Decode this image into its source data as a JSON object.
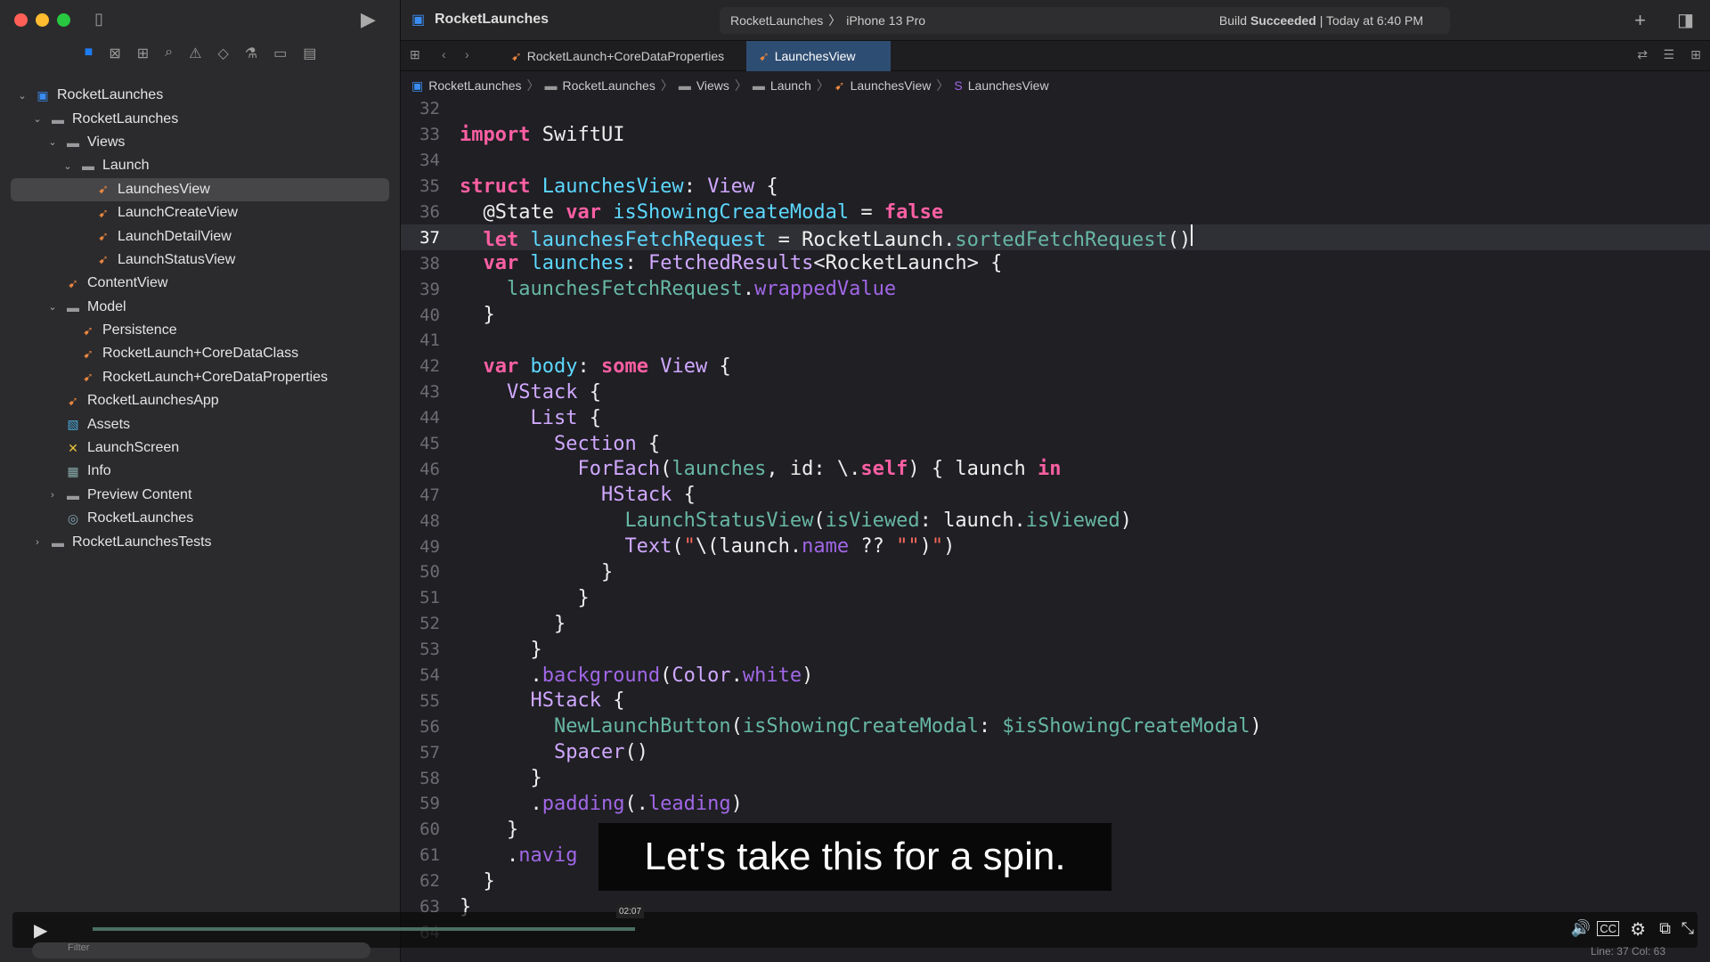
{
  "window": {
    "project": "RocketLaunches",
    "scheme": "RocketLaunches",
    "device": "iPhone 13 Pro",
    "build_status": "Build",
    "build_result": "Succeeded",
    "build_time": "| Today at 6:40 PM"
  },
  "tabs": [
    {
      "label": "RocketLaunch+CoreDataProperties"
    },
    {
      "label": "LaunchesView"
    }
  ],
  "breadcrumb": [
    "RocketLaunches",
    "RocketLaunches",
    "Views",
    "Launch",
    "LaunchesView",
    "LaunchesView"
  ],
  "tree": [
    {
      "label": "RocketLaunches",
      "icon": "app-project",
      "depth": 0,
      "chev": "v"
    },
    {
      "label": "RocketLaunches",
      "icon": "folder",
      "depth": 1,
      "chev": "v"
    },
    {
      "label": "Views",
      "icon": "folder",
      "depth": 2,
      "chev": "v"
    },
    {
      "label": "Launch",
      "icon": "folder",
      "depth": 3,
      "chev": "v"
    },
    {
      "label": "LaunchesView",
      "icon": "swift",
      "depth": 4,
      "selected": true
    },
    {
      "label": "LaunchCreateView",
      "icon": "swift",
      "depth": 4
    },
    {
      "label": "LaunchDetailView",
      "icon": "swift",
      "depth": 4
    },
    {
      "label": "LaunchStatusView",
      "icon": "swift",
      "depth": 4
    },
    {
      "label": "ContentView",
      "icon": "swift",
      "depth": 2
    },
    {
      "label": "Model",
      "icon": "folder",
      "depth": 2,
      "chev": "v"
    },
    {
      "label": "Persistence",
      "icon": "swift",
      "depth": 3
    },
    {
      "label": "RocketLaunch+CoreDataClass",
      "icon": "swift",
      "depth": 3
    },
    {
      "label": "RocketLaunch+CoreDataProperties",
      "icon": "swift",
      "depth": 3
    },
    {
      "label": "RocketLaunchesApp",
      "icon": "swift",
      "depth": 2
    },
    {
      "label": "Assets",
      "icon": "assets",
      "depth": 2
    },
    {
      "label": "LaunchScreen",
      "icon": "storyboard",
      "depth": 2
    },
    {
      "label": "Info",
      "icon": "plist",
      "depth": 2
    },
    {
      "label": "Preview Content",
      "icon": "folder",
      "depth": 2,
      "chev": ">"
    },
    {
      "label": "RocketLaunches",
      "icon": "coredata-model",
      "depth": 2
    },
    {
      "label": "RocketLaunchesTests",
      "icon": "folder",
      "depth": 1,
      "chev": ">"
    }
  ],
  "code": {
    "current_line": 37,
    "lines": [
      {
        "n": "32",
        "t": []
      },
      {
        "n": "33",
        "t": [
          [
            "kw",
            "import"
          ],
          [
            "plain",
            " SwiftUI"
          ]
        ]
      },
      {
        "n": "34",
        "t": []
      },
      {
        "n": "35",
        "t": [
          [
            "kw",
            "struct"
          ],
          [
            "plain",
            " "
          ],
          [
            "decl",
            "LaunchesView"
          ],
          [
            "plain",
            ": "
          ],
          [
            "type",
            "View"
          ],
          [
            "plain",
            " {"
          ]
        ]
      },
      {
        "n": "36",
        "t": [
          [
            "plain",
            "  @State "
          ],
          [
            "kw",
            "var"
          ],
          [
            "plain",
            " "
          ],
          [
            "decl",
            "isShowingCreateModal"
          ],
          [
            "plain",
            " = "
          ],
          [
            "kw",
            "false"
          ]
        ]
      },
      {
        "n": "37",
        "t": [
          [
            "plain",
            "  "
          ],
          [
            "kw",
            "let"
          ],
          [
            "plain",
            " "
          ],
          [
            "decl",
            "launchesFetchRequest"
          ],
          [
            "plain",
            " = RocketLaunch."
          ],
          [
            "proj",
            "sortedFetchRequest"
          ],
          [
            "plain",
            "()"
          ]
        ]
      },
      {
        "n": "38",
        "t": [
          [
            "plain",
            "  "
          ],
          [
            "kw",
            "var"
          ],
          [
            "plain",
            " "
          ],
          [
            "decl",
            "launches"
          ],
          [
            "plain",
            ": "
          ],
          [
            "type",
            "FetchedResults"
          ],
          [
            "plain",
            "<RocketLaunch> {"
          ]
        ]
      },
      {
        "n": "39",
        "t": [
          [
            "plain",
            "    "
          ],
          [
            "proj",
            "launchesFetchRequest"
          ],
          [
            "plain",
            "."
          ],
          [
            "sys",
            "wrappedValue"
          ]
        ]
      },
      {
        "n": "40",
        "t": [
          [
            "plain",
            "  }"
          ]
        ]
      },
      {
        "n": "41",
        "t": []
      },
      {
        "n": "42",
        "t": [
          [
            "plain",
            "  "
          ],
          [
            "kw",
            "var"
          ],
          [
            "plain",
            " "
          ],
          [
            "decl",
            "body"
          ],
          [
            "plain",
            ": "
          ],
          [
            "kw",
            "some"
          ],
          [
            "plain",
            " "
          ],
          [
            "type",
            "View"
          ],
          [
            "plain",
            " {"
          ]
        ]
      },
      {
        "n": "43",
        "t": [
          [
            "plain",
            "    "
          ],
          [
            "type",
            "VStack"
          ],
          [
            "plain",
            " {"
          ]
        ]
      },
      {
        "n": "44",
        "t": [
          [
            "plain",
            "      "
          ],
          [
            "type",
            "List"
          ],
          [
            "plain",
            " {"
          ]
        ]
      },
      {
        "n": "45",
        "t": [
          [
            "plain",
            "        "
          ],
          [
            "type",
            "Section"
          ],
          [
            "plain",
            " {"
          ]
        ]
      },
      {
        "n": "46",
        "t": [
          [
            "plain",
            "          "
          ],
          [
            "type",
            "ForEach"
          ],
          [
            "plain",
            "("
          ],
          [
            "proj",
            "launches"
          ],
          [
            "plain",
            ", id: \\."
          ],
          [
            "kw",
            "self"
          ],
          [
            "plain",
            ") { launch "
          ],
          [
            "kw",
            "in"
          ]
        ]
      },
      {
        "n": "47",
        "t": [
          [
            "plain",
            "            "
          ],
          [
            "type",
            "HStack"
          ],
          [
            "plain",
            " {"
          ]
        ]
      },
      {
        "n": "48",
        "t": [
          [
            "plain",
            "              "
          ],
          [
            "proj",
            "LaunchStatusView"
          ],
          [
            "plain",
            "("
          ],
          [
            "proj",
            "isViewed"
          ],
          [
            "plain",
            ": launch."
          ],
          [
            "proj",
            "isViewed"
          ],
          [
            "plain",
            ")"
          ]
        ]
      },
      {
        "n": "49",
        "t": [
          [
            "plain",
            "              "
          ],
          [
            "type",
            "Text"
          ],
          [
            "plain",
            "("
          ],
          [
            "str",
            "\""
          ],
          [
            "plain",
            "\\(launch."
          ],
          [
            "sys",
            "name"
          ],
          [
            "plain",
            " ?? "
          ],
          [
            "str",
            "\"\""
          ],
          [
            "plain",
            ")"
          ],
          [
            "str",
            "\""
          ],
          [
            "plain",
            ")"
          ]
        ]
      },
      {
        "n": "50",
        "t": [
          [
            "plain",
            "            }"
          ]
        ]
      },
      {
        "n": "51",
        "t": [
          [
            "plain",
            "          }"
          ]
        ]
      },
      {
        "n": "52",
        "t": [
          [
            "plain",
            "        }"
          ]
        ]
      },
      {
        "n": "53",
        "t": [
          [
            "plain",
            "      }"
          ]
        ]
      },
      {
        "n": "54",
        "t": [
          [
            "plain",
            "      ."
          ],
          [
            "sys",
            "background"
          ],
          [
            "plain",
            "("
          ],
          [
            "type",
            "Color"
          ],
          [
            "plain",
            "."
          ],
          [
            "sys",
            "white"
          ],
          [
            "plain",
            ")"
          ]
        ]
      },
      {
        "n": "55",
        "t": [
          [
            "plain",
            "      "
          ],
          [
            "type",
            "HStack"
          ],
          [
            "plain",
            " {"
          ]
        ]
      },
      {
        "n": "56",
        "t": [
          [
            "plain",
            "        "
          ],
          [
            "proj",
            "NewLaunchButton"
          ],
          [
            "plain",
            "("
          ],
          [
            "proj",
            "isShowingCreateModal"
          ],
          [
            "plain",
            ": "
          ],
          [
            "proj",
            "$isShowingCreateModal"
          ],
          [
            "plain",
            ")"
          ]
        ]
      },
      {
        "n": "57",
        "t": [
          [
            "plain",
            "        "
          ],
          [
            "type",
            "Spacer"
          ],
          [
            "plain",
            "()"
          ]
        ]
      },
      {
        "n": "58",
        "t": [
          [
            "plain",
            "      }"
          ]
        ]
      },
      {
        "n": "59",
        "t": [
          [
            "plain",
            "      ."
          ],
          [
            "sys",
            "padding"
          ],
          [
            "plain",
            "(."
          ],
          [
            "sys",
            "leading"
          ],
          [
            "plain",
            ")"
          ]
        ]
      },
      {
        "n": "60",
        "t": [
          [
            "plain",
            "    }"
          ]
        ]
      },
      {
        "n": "61",
        "t": [
          [
            "plain",
            "    ."
          ],
          [
            "sys",
            "navig"
          ]
        ]
      },
      {
        "n": "62",
        "t": [
          [
            "plain",
            "  }"
          ]
        ]
      },
      {
        "n": "63",
        "t": [
          [
            "plain",
            "}"
          ]
        ]
      },
      {
        "n": "64",
        "t": []
      }
    ]
  },
  "video": {
    "subtitle": "Let's take this for a spin.",
    "time_tooltip": "02:07",
    "progress_percent": 36
  },
  "status": {
    "filter_placeholder": "Filter",
    "cursor": "Line: 37  Col: 63"
  },
  "colors": {
    "accent": "#2e4d72",
    "progress": "#4a6f62",
    "keyword": "#fc5fa3"
  }
}
